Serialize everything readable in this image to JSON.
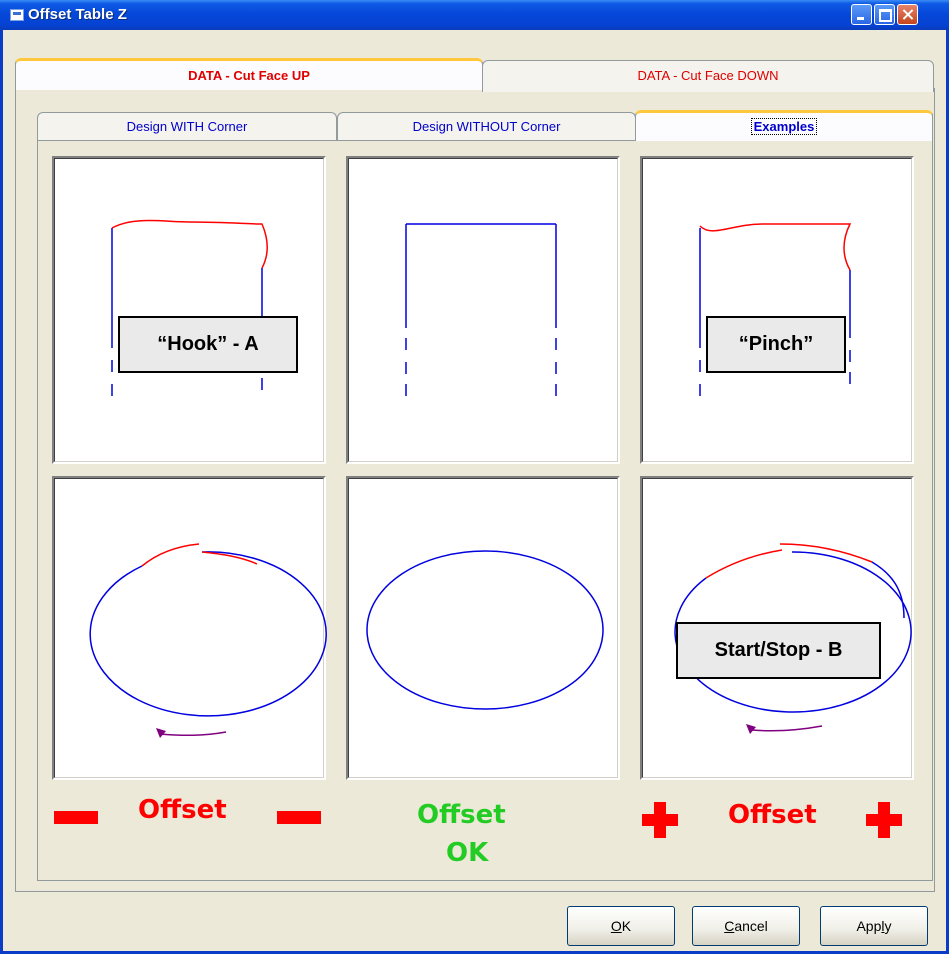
{
  "window": {
    "title": "Offset Table Z"
  },
  "outer_tabs": [
    {
      "label": "DATA - Cut Face UP",
      "selected": true
    },
    {
      "label": "DATA - Cut Face DOWN",
      "selected": false
    }
  ],
  "inner_tabs": [
    {
      "label": "Design WITH Corner",
      "selected": false
    },
    {
      "label": "Design WITHOUT Corner",
      "selected": false
    },
    {
      "label": "Examples",
      "selected": true
    }
  ],
  "examples": {
    "hook_label": "“Hook” - A",
    "pinch_label": "“Pinch”",
    "startstop_label": "Start/Stop - B"
  },
  "offset_legend": {
    "minus_text": "Offset",
    "ok_text_line1": "Offset",
    "ok_text_line2": "OK",
    "plus_text": "Offset"
  },
  "buttons": {
    "ok_prefix": "",
    "ok_underline": "O",
    "ok_rest": "K",
    "cancel_underline": "C",
    "cancel_rest": "ancel",
    "apply_prefix": "App",
    "apply_underline": "l",
    "apply_rest": "y"
  },
  "colors": {
    "shape_line": "#0000e0",
    "offset_segment": "#ff0000",
    "direction_arrow": "#800080",
    "minus_offset": "#ff0000",
    "ok_offset": "#22cc22"
  }
}
